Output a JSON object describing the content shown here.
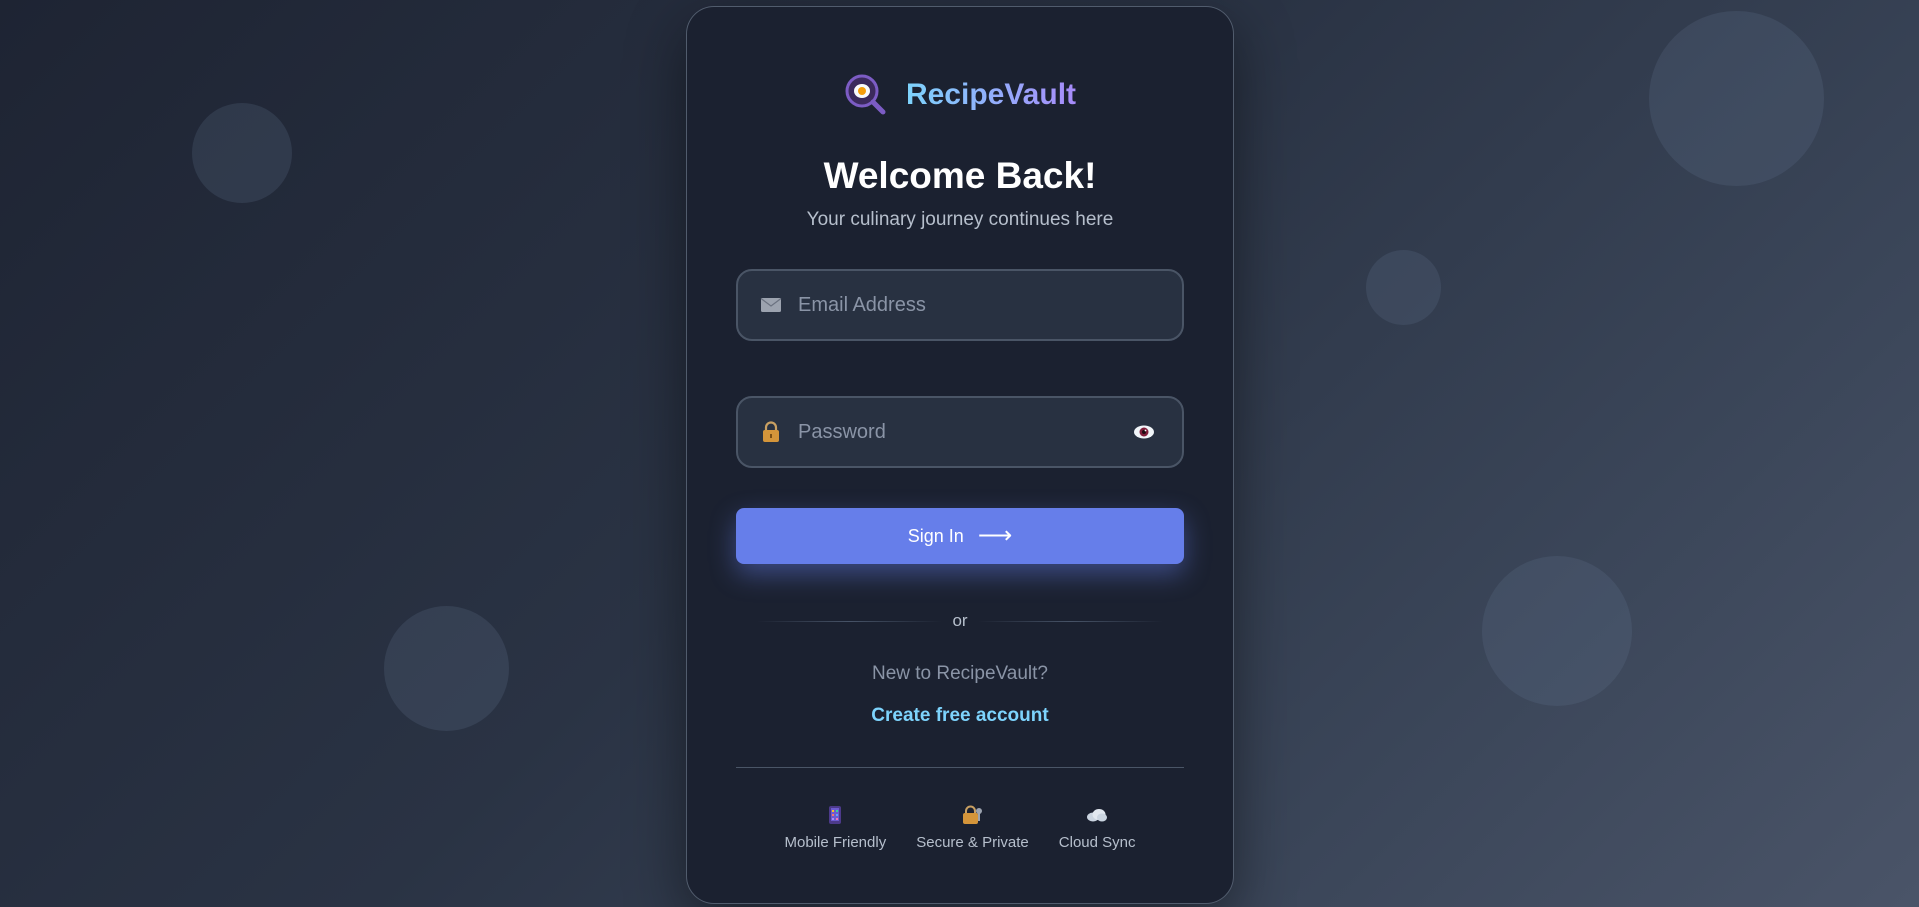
{
  "brand": {
    "name": "RecipeVault",
    "logo_icon": "frying-pan-egg-icon"
  },
  "header": {
    "title": "Welcome Back!",
    "subtitle": "Your culinary journey continues here"
  },
  "form": {
    "email": {
      "placeholder": "Email Address",
      "value": "",
      "icon": "envelope-icon"
    },
    "password": {
      "placeholder": "Password",
      "value": "",
      "icon": "lock-icon",
      "toggle_icon": "eye-icon"
    },
    "submit": {
      "label": "Sign In",
      "arrow": "⟶"
    }
  },
  "divider": {
    "text": "or"
  },
  "signup": {
    "prompt": "New to RecipeVault?",
    "link_label": "Create free account"
  },
  "features": [
    {
      "label": "Mobile Friendly",
      "icon": "mobile-phone-icon"
    },
    {
      "label": "Secure & Private",
      "icon": "lock-key-icon"
    },
    {
      "label": "Cloud Sync",
      "icon": "cloud-icon"
    }
  ],
  "colors": {
    "accent": "#667eea",
    "link": "#7dd3fc",
    "brand_gradient_start": "#7dd3fc",
    "brand_gradient_end": "#a78bfa",
    "card_bg": "#1b2130"
  }
}
